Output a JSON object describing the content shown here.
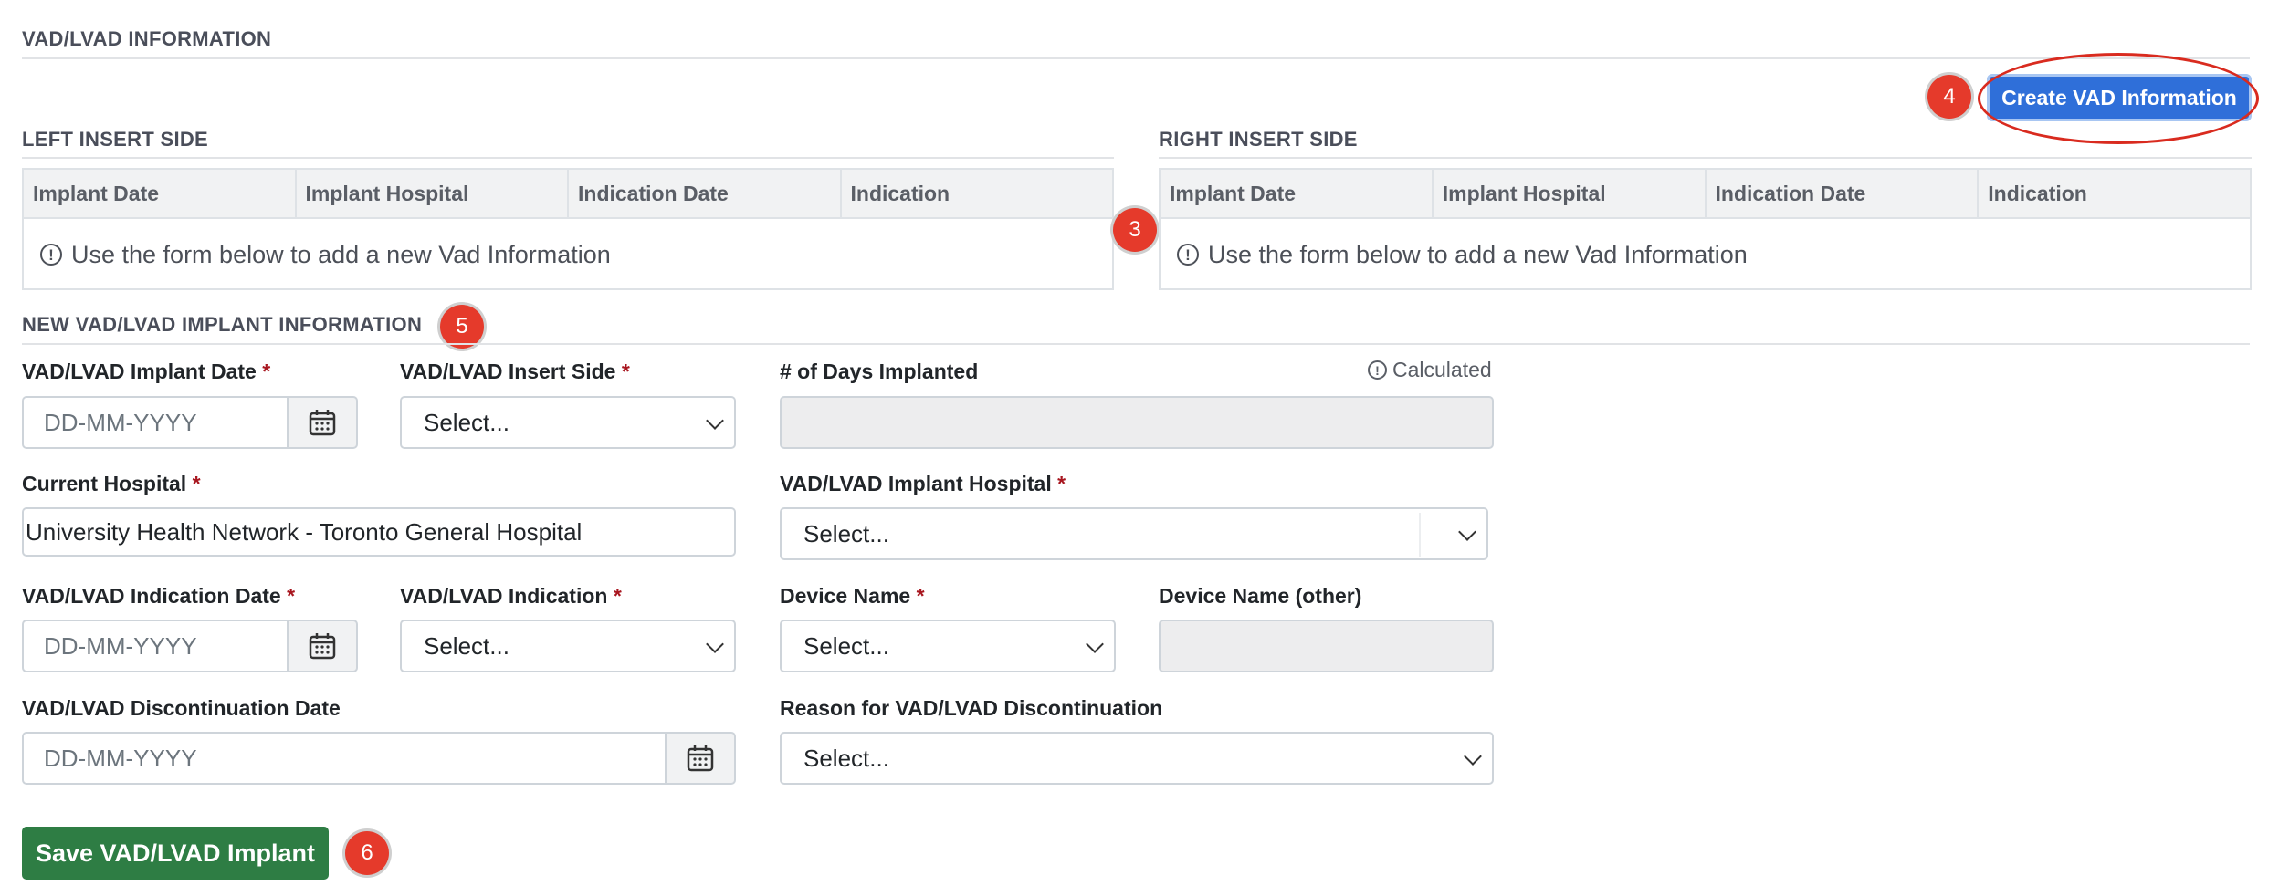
{
  "vad_section": {
    "title": "VAD/LVAD INFORMATION"
  },
  "create_button": {
    "label": "Create VAD Information"
  },
  "left_insert": {
    "title": "LEFT INSERT SIDE",
    "columns": [
      "Implant Date",
      "Implant Hospital",
      "Indication Date",
      "Indication"
    ],
    "empty_message": "Use the form below to add a new Vad Information"
  },
  "right_insert": {
    "title": "RIGHT INSERT SIDE",
    "columns": [
      "Implant Date",
      "Implant Hospital",
      "Indication Date",
      "Indication"
    ],
    "empty_message": "Use the form below to add a new Vad Information"
  },
  "new_section": {
    "title": "NEW VAD/LVAD IMPLANT INFORMATION"
  },
  "markers": {
    "m3": "3",
    "m4": "4",
    "m5": "5",
    "m6": "6"
  },
  "form": {
    "implant_date": {
      "label": "VAD/LVAD Implant Date",
      "placeholder": "DD-MM-YYYY"
    },
    "insert_side": {
      "label": "VAD/LVAD Insert Side",
      "value": "Select..."
    },
    "days_implanted": {
      "label": "# of Days Implanted",
      "note": "Calculated"
    },
    "current_hospital": {
      "label": "Current Hospital",
      "value": "University Health Network - Toronto General Hospital"
    },
    "implant_hospital": {
      "label": "VAD/LVAD Implant Hospital",
      "value": "Select..."
    },
    "indication_date": {
      "label": "VAD/LVAD Indication Date",
      "placeholder": "DD-MM-YYYY"
    },
    "indication": {
      "label": "VAD/LVAD Indication",
      "value": "Select..."
    },
    "device_name": {
      "label": "Device Name",
      "value": "Select..."
    },
    "device_name_other": {
      "label": "Device Name (other)"
    },
    "discontinuation_date": {
      "label": "VAD/LVAD Discontinuation Date",
      "placeholder": "DD-MM-YYYY"
    },
    "discontinuation_reason": {
      "label": "Reason for VAD/LVAD Discontinuation",
      "value": "Select..."
    },
    "required_mark": "*"
  },
  "save_button": {
    "label": "Save VAD/LVAD Implant"
  },
  "colors": {
    "primary": "#2f6fd9",
    "success": "#2e7d44",
    "marker": "#e53a2b",
    "required": "#a8161f"
  },
  "icons": [
    "info-icon",
    "calendar-icon",
    "chevron-down-icon"
  ]
}
